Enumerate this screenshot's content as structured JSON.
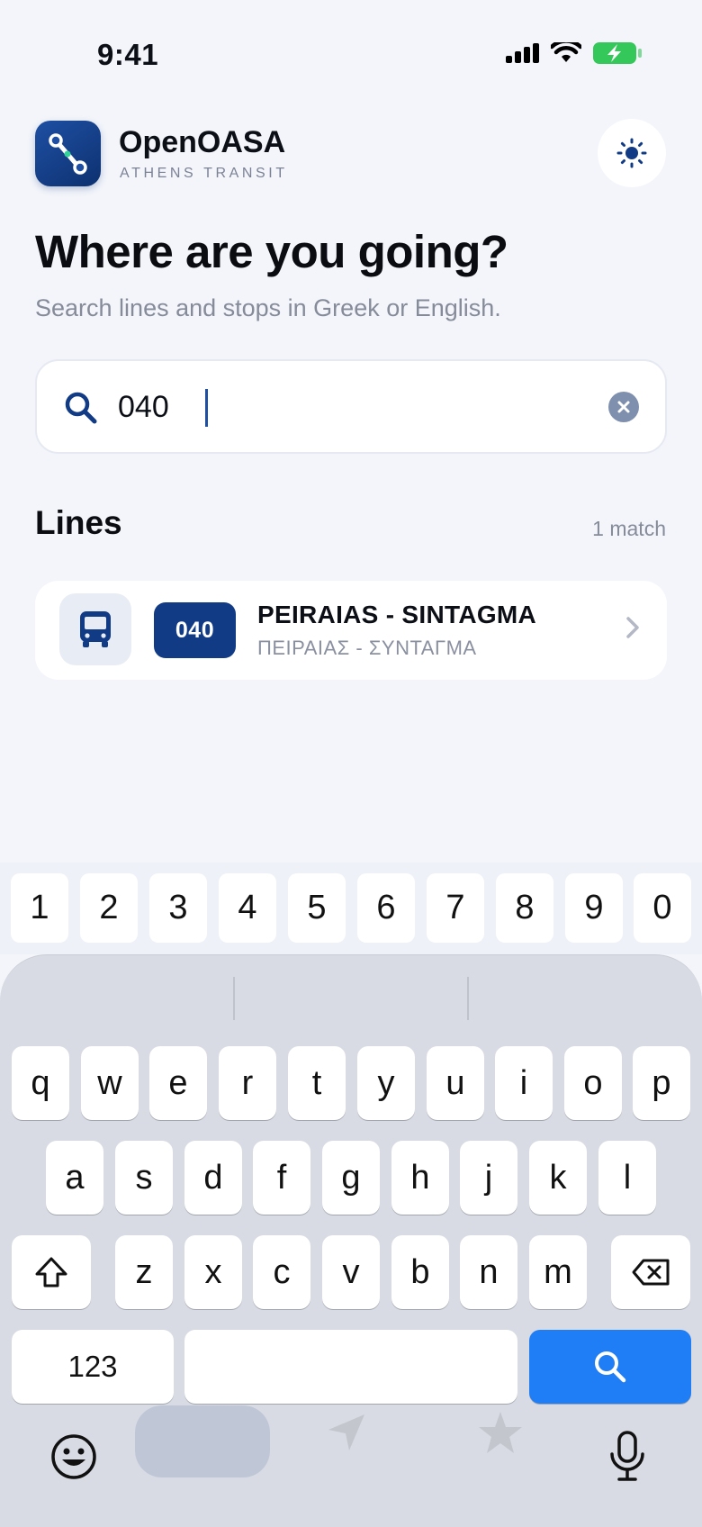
{
  "status_bar": {
    "time": "9:41"
  },
  "header": {
    "app_title": "OpenOASA",
    "app_subtitle": "ATHENS TRANSIT"
  },
  "hero": {
    "title": "Where are you going?",
    "subtitle": "Search lines and stops in Greek or English."
  },
  "search": {
    "value": "040"
  },
  "results": {
    "section_title": "Lines",
    "count": "1 match",
    "items": [
      {
        "line_number": "040",
        "name": "PEIRAIAS - SINTAGMA",
        "name_greek": "ΠΕΙΡΑΙΑΣ - ΣΥΝΤΑΓΜΑ"
      }
    ]
  },
  "keyboard": {
    "numbers": [
      "1",
      "2",
      "3",
      "4",
      "5",
      "6",
      "7",
      "8",
      "9",
      "0"
    ],
    "row1": [
      "q",
      "w",
      "e",
      "r",
      "t",
      "y",
      "u",
      "i",
      "o",
      "p"
    ],
    "row2": [
      "a",
      "s",
      "d",
      "f",
      "g",
      "h",
      "j",
      "k",
      "l"
    ],
    "row3": [
      "z",
      "x",
      "c",
      "v",
      "b",
      "n",
      "m"
    ],
    "mode_key": "123"
  },
  "colors": {
    "accent": "#123b86",
    "search_key": "#1f7ef5",
    "battery": "#34c759"
  }
}
